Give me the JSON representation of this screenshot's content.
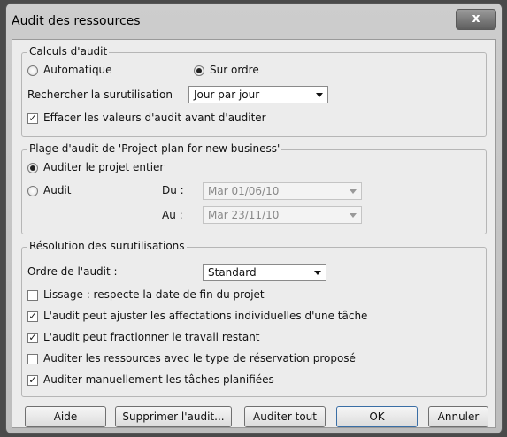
{
  "window": {
    "title": "Audit des ressources",
    "close_glyph": "x"
  },
  "calculs": {
    "legend": "Calculs d'audit",
    "radio_auto": "Automatique",
    "radio_manual": "Sur ordre",
    "rechercher_label": "Rechercher la surutilisation",
    "rechercher_value": "Jour par jour",
    "effacer_label": "Effacer les valeurs d'audit avant d'auditer"
  },
  "plage": {
    "legend": "Plage d'audit de 'Project plan for new business'",
    "radio_entier": "Auditer le projet entier",
    "radio_audit": "Audit",
    "du_label": "Du :",
    "du_value": "Mar 01/06/10",
    "au_label": "Au :",
    "au_value": "Mar 23/11/10"
  },
  "resolution": {
    "legend": "Résolution des surutilisations",
    "ordre_label": "Ordre de l'audit :",
    "ordre_value": "Standard",
    "options": [
      {
        "label": "Lissage : respecte la date de fin du projet",
        "checked": false
      },
      {
        "label": "L'audit peut ajuster les affectations individuelles d'une tâche",
        "checked": true
      },
      {
        "label": "L'audit peut fractionner le travail restant",
        "checked": true
      },
      {
        "label": "Auditer les ressources avec le type de réservation proposé",
        "checked": false
      },
      {
        "label": "Auditer manuellement les tâches planifiées",
        "checked": true
      }
    ]
  },
  "buttons": {
    "aide": "Aide",
    "supprimer": "Supprimer l'audit...",
    "auditer_tout": "Auditer tout",
    "ok": "OK",
    "annuler": "Annuler"
  },
  "state": {
    "calc_mode": "Sur ordre",
    "range_mode": "Auditer le projet entier",
    "effacer_checked": true
  },
  "icons": {
    "close": "close-icon",
    "dropdown": "chevron-down-icon",
    "check": "checkmark-icon"
  }
}
